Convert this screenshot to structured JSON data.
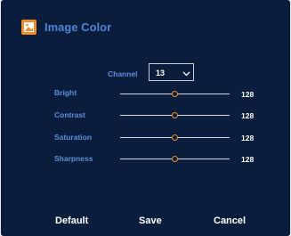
{
  "dialog": {
    "title": "Image Color",
    "icon": "image-icon",
    "accent_color": "#f28c28"
  },
  "channel": {
    "label": "Channel",
    "selected": "13",
    "dropdown_icon": "chevron-down-icon"
  },
  "adjustments": [
    {
      "label": "Bright",
      "value": "128",
      "level": 0.5
    },
    {
      "label": "Contrast",
      "value": "128",
      "level": 0.5
    },
    {
      "label": "Saturation",
      "value": "128",
      "level": 0.5
    },
    {
      "label": "Sharpness",
      "value": "128",
      "level": 0.5
    }
  ],
  "buttons": {
    "default": "Default",
    "save": "Save",
    "cancel": "Cancel"
  }
}
